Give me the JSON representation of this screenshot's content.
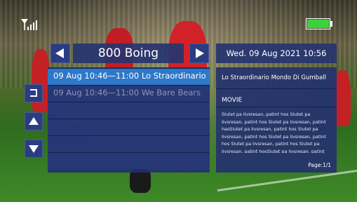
{
  "channel": {
    "name": "800 Boing"
  },
  "clock": {
    "datetime": "Wed. 09 Aug 2021 10:56"
  },
  "epg_list": {
    "items": [
      {
        "label": "09 Aug 10:46—11:00 Lo Straordinario",
        "selected": true
      },
      {
        "label": "09 Aug 10:46—11:00 We Bare Bears",
        "selected": false
      },
      {
        "label": "",
        "selected": false
      },
      {
        "label": "",
        "selected": false
      },
      {
        "label": "",
        "selected": false
      },
      {
        "label": "",
        "selected": false
      }
    ]
  },
  "detail": {
    "title": "Lo Straordinario Mondo Di Gumball",
    "category": "MOVIE",
    "description": "Slutet pa livsresan, patint hos Slutet pa livsresan, patint hos Slutet pa livsresan, patint hasSlutet pa livsresan, patint hos Slutet pa livsresan, patint hos Slutet pa livsresan, patint hos Slutet pa livsresan, patint hos Slutet pa livsresan, patint hosSlutet pa livsresan, patint hos",
    "page": "Page:1/1"
  },
  "status": {
    "battery_level": 1.0
  },
  "icons": {
    "signal": "signal-icon",
    "battery": "battery-icon",
    "prev": "arrow-left-icon",
    "next": "arrow-right-icon",
    "back": "return-icon",
    "up": "arrow-up-icon",
    "down": "arrow-down-icon"
  },
  "colors": {
    "panel": "#263470",
    "selected": "#2e78c9",
    "battery": "#3cd23c"
  }
}
